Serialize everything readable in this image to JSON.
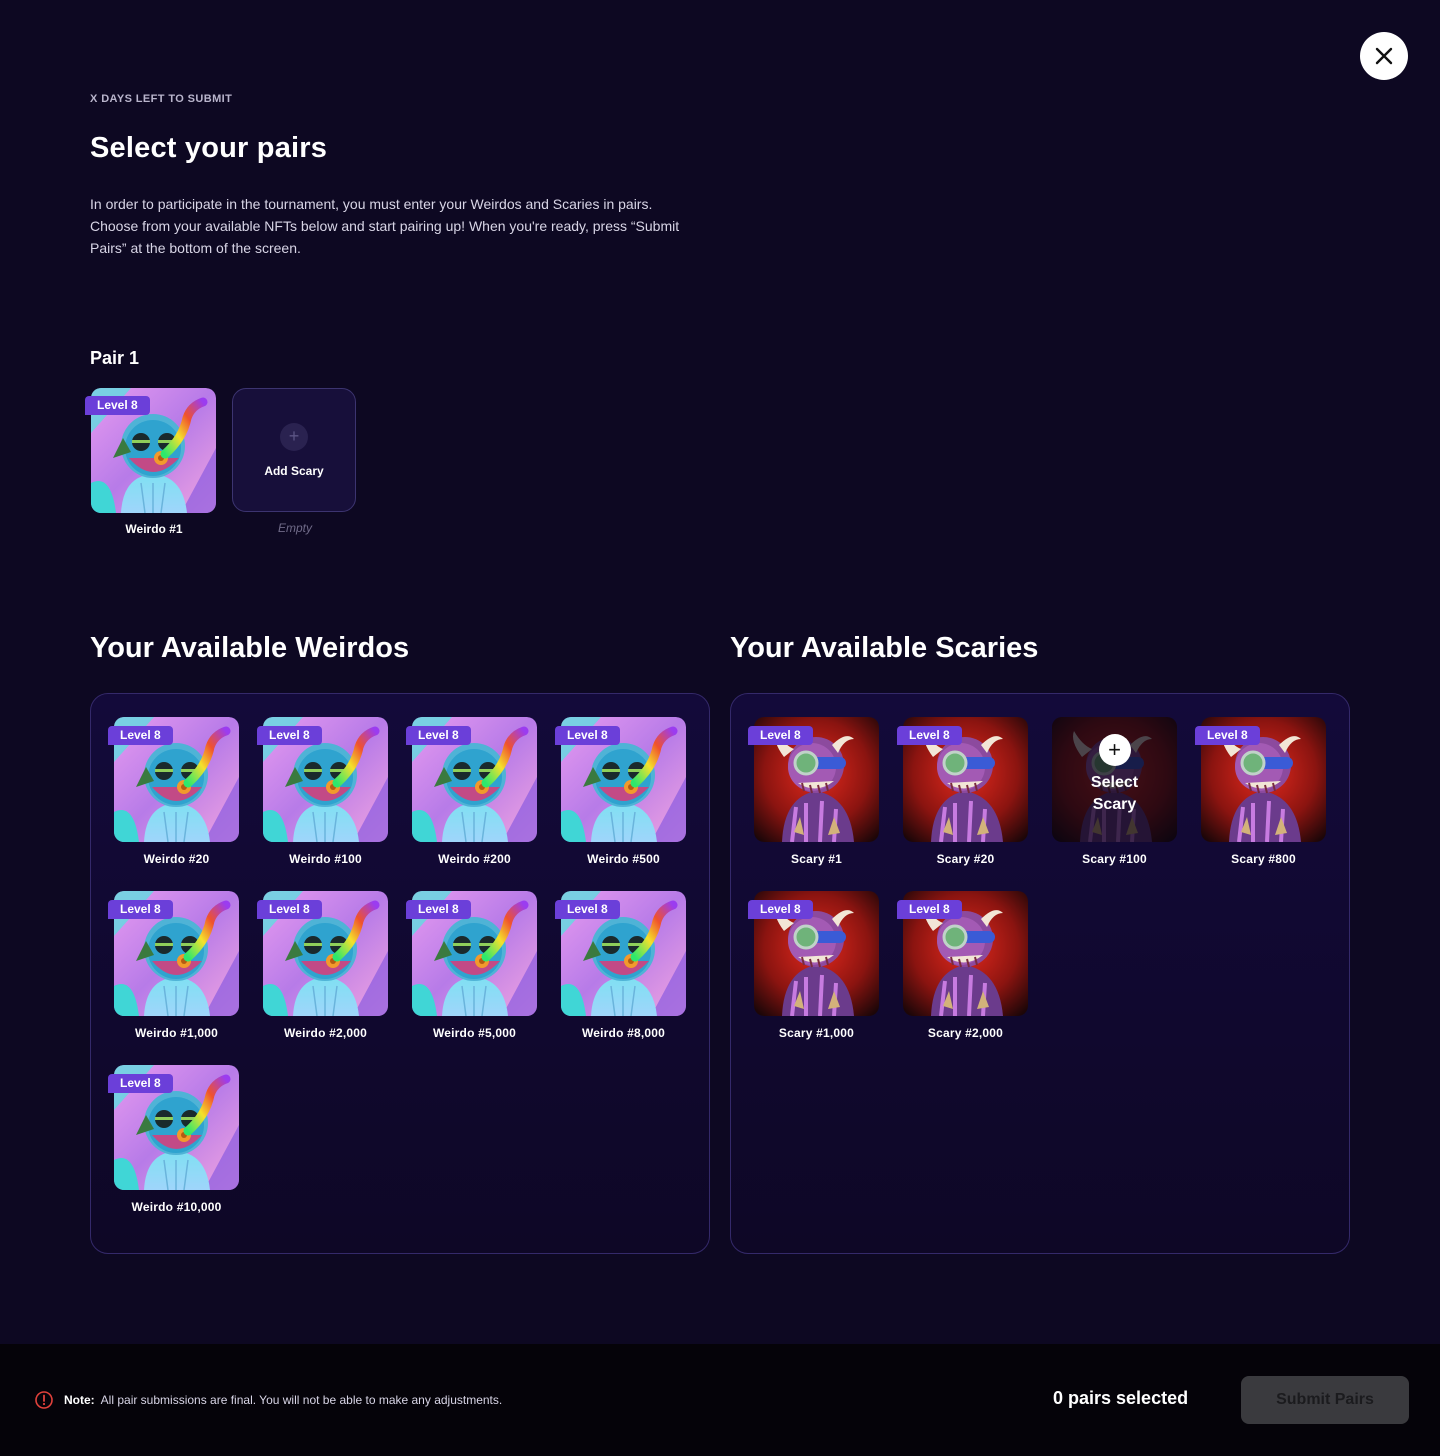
{
  "header": {
    "eyebrow": "X DAYS LEFT TO SUBMIT",
    "title": "Select your pairs",
    "intro": "In order to participate in the tournament, you must enter your Weirdos and Scaries in pairs. Choose from your available NFTs below and start pairing up! When you're ready, press “Submit Pairs” at the bottom of the screen."
  },
  "pair": {
    "title": "Pair 1",
    "weirdo": {
      "badge": "Level 8",
      "name": "Weirdo #1"
    },
    "scary": {
      "action": "Add Scary",
      "caption": "Empty"
    }
  },
  "weirdos": {
    "title": "Your Available Weirdos",
    "items": [
      {
        "badge": "Level 8",
        "name": "Weirdo #20"
      },
      {
        "badge": "Level 8",
        "name": "Weirdo #100"
      },
      {
        "badge": "Level 8",
        "name": "Weirdo #200"
      },
      {
        "badge": "Level 8",
        "name": "Weirdo #500"
      },
      {
        "badge": "Level 8",
        "name": "Weirdo #1,000"
      },
      {
        "badge": "Level 8",
        "name": "Weirdo #2,000"
      },
      {
        "badge": "Level 8",
        "name": "Weirdo #5,000"
      },
      {
        "badge": "Level 8",
        "name": "Weirdo #8,000"
      },
      {
        "badge": "Level 8",
        "name": "Weirdo #10,000"
      }
    ]
  },
  "scaries": {
    "title": "Your Available Scaries",
    "items": [
      {
        "badge": "Level 8",
        "name": "Scary #1"
      },
      {
        "badge": "Level 8",
        "name": "Scary #20"
      },
      {
        "badge": "",
        "name": "Scary #100",
        "overlay": "Select Scary"
      },
      {
        "badge": "Level 8",
        "name": "Scary #800"
      },
      {
        "badge": "Level 8",
        "name": "Scary #1,000"
      },
      {
        "badge": "Level 8",
        "name": "Scary #2,000"
      }
    ]
  },
  "footer": {
    "note_label": "Note:",
    "note_text": "All pair submissions are final. You will not be able to make any adjustments.",
    "pairs_selected": "0 pairs selected",
    "submit_label": "Submit Pairs"
  },
  "colors": {
    "background": "#0d0822",
    "badge": "#6b3fd9",
    "panel_border": "#34296a",
    "warning": "#e0413b"
  },
  "icons": {
    "close": "close-icon",
    "warning": "warning-circle-icon",
    "add": "plus-icon"
  }
}
